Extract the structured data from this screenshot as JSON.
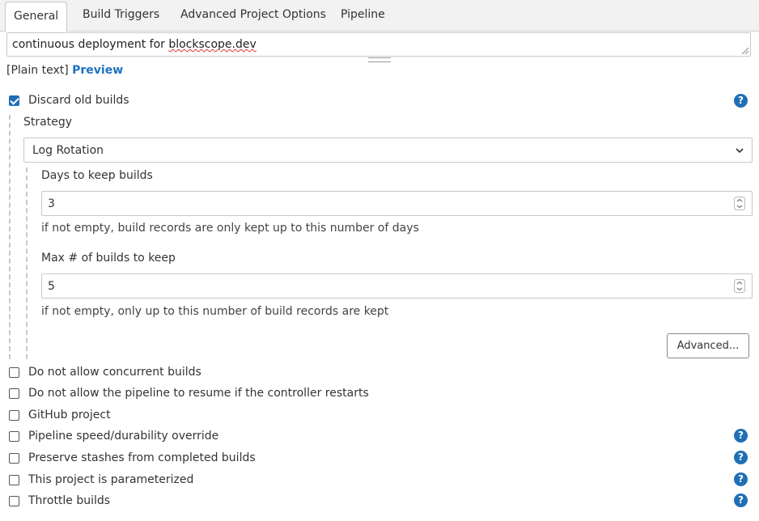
{
  "tabs": [
    {
      "label": "General"
    },
    {
      "label": "Build Triggers"
    },
    {
      "label": "Advanced Project Options"
    },
    {
      "label": "Pipeline"
    }
  ],
  "description": {
    "prefix": "continuous deployment for ",
    "misspelled": "blockscope.dev"
  },
  "format": {
    "plain": "[Plain text]",
    "preview": "Preview"
  },
  "discard": {
    "label": "Discard old builds",
    "checked": true,
    "help": "?",
    "strategy_label": "Strategy",
    "strategy_value": "Log Rotation",
    "days_label": "Days to keep builds",
    "days_value": "3",
    "days_hint": "if not empty, build records are only kept up to this number of days",
    "max_label": "Max # of builds to keep",
    "max_value": "5",
    "max_hint": "if not empty, only up to this number of build records are kept",
    "advanced_button": "Advanced..."
  },
  "options": [
    {
      "label": "Do not allow concurrent builds",
      "checked": false,
      "help": ""
    },
    {
      "label": "Do not allow the pipeline to resume if the controller restarts",
      "checked": false,
      "help": ""
    },
    {
      "label": "GitHub project",
      "checked": false,
      "help": ""
    },
    {
      "label": "Pipeline speed/durability override",
      "checked": false,
      "help": "?"
    },
    {
      "label": "Preserve stashes from completed builds",
      "checked": false,
      "help": "?"
    },
    {
      "label": "This project is parameterized",
      "checked": false,
      "help": "?"
    },
    {
      "label": "Throttle builds",
      "checked": false,
      "help": "?"
    }
  ],
  "colors": {
    "accent": "#1f6fb5",
    "link": "#1a73c1"
  }
}
